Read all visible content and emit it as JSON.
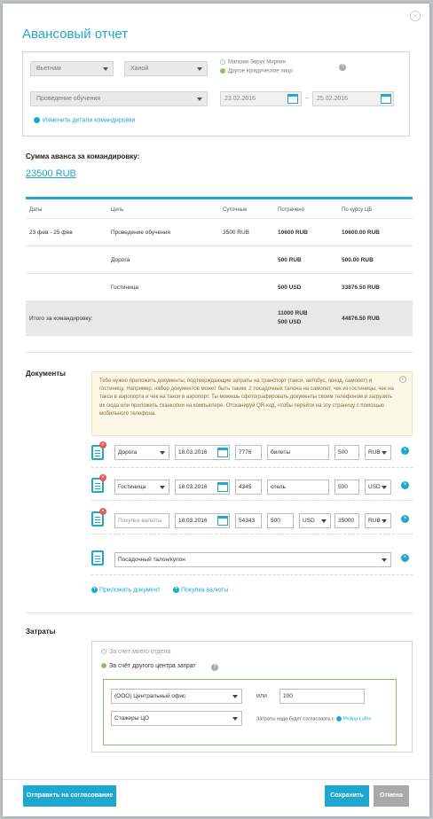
{
  "modal": {
    "title": "Авансовый отчет",
    "close": "×"
  },
  "details": {
    "country": "Вьетнам",
    "city": "Ханой",
    "radio1": "Магазин Эврух Мирпин",
    "radio2": "Другое юридическое лицо",
    "purpose": "Проведение обучения",
    "date_from": "23.02.2016",
    "date_to": "25.02.2016",
    "dash": "–",
    "edit_link": "Изменить детали командировки",
    "help": "?"
  },
  "advance": {
    "label": "Сумма аванса за командировку:",
    "amount": "23500 RUB"
  },
  "table": {
    "headers": [
      "Даты",
      "Цель",
      "Суточные",
      "Потрачено",
      "По курсу ЦБ"
    ],
    "rows": [
      {
        "dates": "23 фев - 25 фев",
        "purpose": "Проведение обучения",
        "daily": "3500 RUB",
        "spent": "10600 RUB",
        "cb": "10600.00 RUB"
      },
      {
        "dates": "",
        "purpose": "Дорога",
        "daily": "",
        "spent": "500 RUB",
        "cb": "500.00 RUB"
      },
      {
        "dates": "",
        "purpose": "Гостиница",
        "daily": "",
        "spent": "500 USD",
        "cb": "33876.50 RUB"
      }
    ],
    "total": {
      "label": "Итого за командировку:",
      "spent1": "11000 RUB",
      "spent2": "500 USD",
      "cb": "44876.50 RUB"
    }
  },
  "documents": {
    "label": "Документы",
    "note": "Тебе нужно приложить документы, подтверждающие затраты на транспорт (такси, автобус, поезд, самолет) и гостиницу. Например, набор документов может быть таким: 2 посадочных талона на самолет, чек из гостиницы, чек на такси в аэропорта и чек на такси в аэропорт. Ты можешь сфотографировать документы своим телефоном и загрузить их сюда или приложить сканкопии на компьютере. Отсканируй QR-код, чтобы перейти на эту страницу с помощью мобильного телефона.",
    "rows": [
      {
        "type": "Дорога",
        "date": "18.03.2016",
        "num": "7776",
        "desc": "билеты",
        "amount": "500",
        "cur": "RUB"
      },
      {
        "type": "Гостиница",
        "date": "18.03.2016",
        "num": "4345",
        "desc": "отель",
        "amount": "500",
        "cur": "USD"
      },
      {
        "type": "Покупка валюты",
        "date": "18.03.2016",
        "num": "54343",
        "amount1": "500",
        "cur1": "USD",
        "amount2": "35000",
        "cur2": "RUB"
      },
      {
        "type": "Посадочный талон/купон"
      }
    ],
    "add_doc": "Приложить документ",
    "buy_currency": "Покупка валюты"
  },
  "costs": {
    "label": "Затраты",
    "opt1": "За счет моего отдела",
    "opt2": "За счёт другого центра затрат",
    "office": "(ООО) Центральный офис",
    "or": "или",
    "code": "100",
    "group": "Стажеры ЦО",
    "approve": "Затраты надо будет согласовать с",
    "approver": "Philipp Lafen"
  },
  "footer": {
    "send": "Отправить на согласование",
    "save": "Сохранить",
    "cancel": "Отмена"
  },
  "colors": {
    "accent": "#1ea7d0",
    "ok": "#8ac26b",
    "danger": "#e25d5d"
  }
}
